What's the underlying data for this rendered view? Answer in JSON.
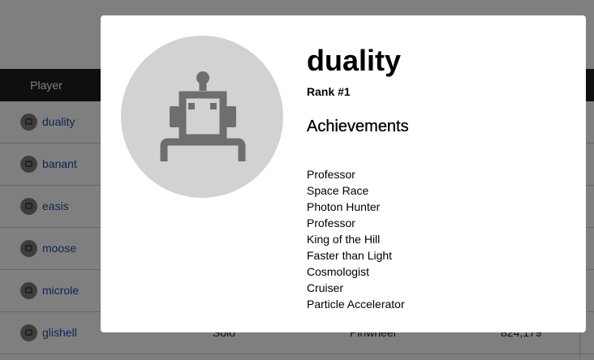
{
  "leaderboard": {
    "header_player": "Player",
    "rows": [
      {
        "name": "duality",
        "mode": "",
        "ship": "",
        "score": ""
      },
      {
        "name": "banant",
        "mode": "",
        "ship": "",
        "score": ""
      },
      {
        "name": "easis",
        "mode": "",
        "ship": "",
        "score": ""
      },
      {
        "name": "moose",
        "mode": "",
        "ship": "",
        "score": ""
      },
      {
        "name": "microle",
        "mode": "",
        "ship": "",
        "score": ""
      },
      {
        "name": "glishell",
        "mode": "Solo",
        "ship": "Pinwheel",
        "score": "824,179"
      }
    ]
  },
  "profile": {
    "avatar_icon": "robot-icon",
    "name": "duality",
    "rank": "Rank #1",
    "achievements_title": "Achievements",
    "achievements": [
      "Professor",
      "Space Race",
      "Photon Hunter",
      "Professor",
      "King of the Hill",
      "Faster than Light",
      "Cosmologist",
      "Cruiser",
      "Particle Accelerator"
    ]
  },
  "colors": {
    "overlay": "#000000",
    "link": "#1f4ea6",
    "header_bg": "#1f1f1f",
    "avatar_bg": "#d2d2d2",
    "robot": "#6e6e6e"
  }
}
